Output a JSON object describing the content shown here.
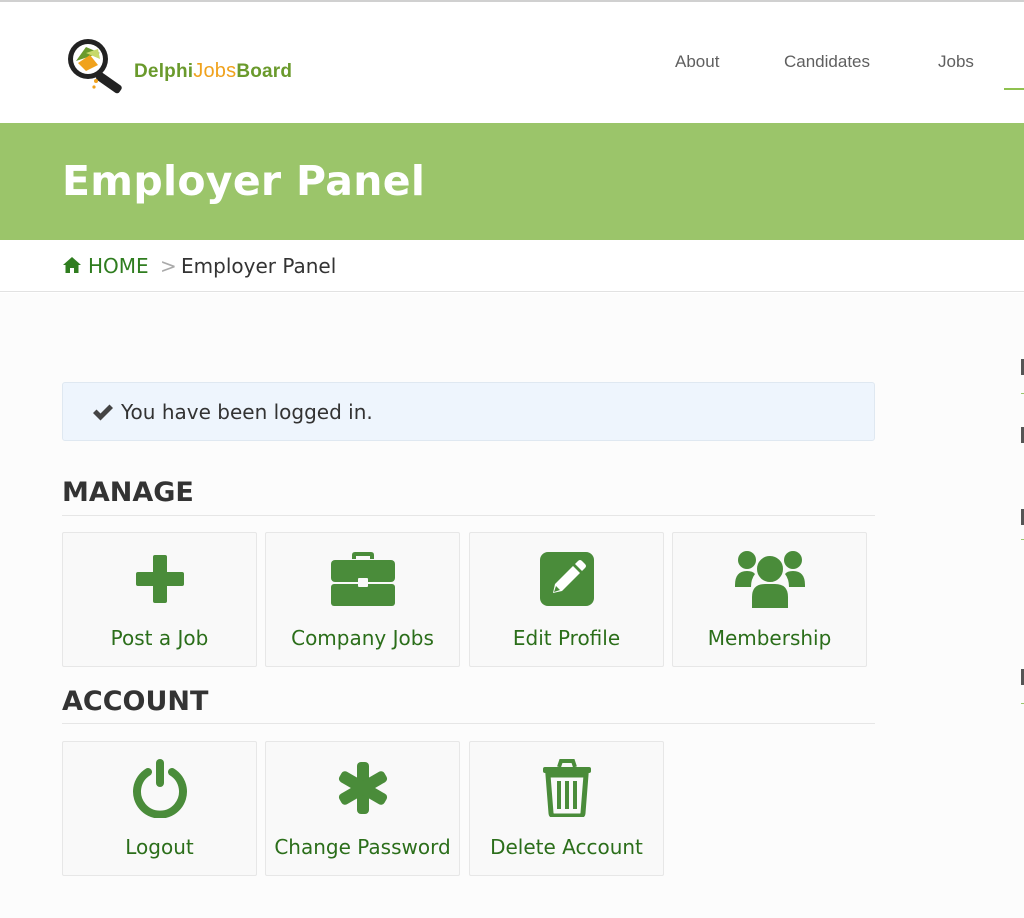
{
  "header": {
    "logo": {
      "part1": "Delphi",
      "part2": "Jobs",
      "part3": "Board",
      "icon": "magnifier-logo-icon"
    },
    "nav": [
      {
        "label": "About"
      },
      {
        "label": "Candidates"
      },
      {
        "label": "Jobs"
      }
    ]
  },
  "banner": {
    "title": "Employer Panel"
  },
  "breadcrumb": {
    "home": "HOME",
    "separator": ">",
    "current": "Employer Panel",
    "home_icon": "home-icon"
  },
  "alert": {
    "icon": "check-icon",
    "text": "You have been logged in."
  },
  "sections": {
    "manage": {
      "title": "MANAGE",
      "tiles": [
        {
          "label": "Post a Job",
          "icon": "plus-icon"
        },
        {
          "label": "Company Jobs",
          "icon": "briefcase-icon"
        },
        {
          "label": "Edit Profile",
          "icon": "edit-icon"
        },
        {
          "label": "Membership",
          "icon": "users-icon"
        }
      ]
    },
    "account": {
      "title": "ACCOUNT",
      "tiles": [
        {
          "label": "Logout",
          "icon": "power-icon"
        },
        {
          "label": "Change Password",
          "icon": "asterisk-icon"
        },
        {
          "label": "Delete Account",
          "icon": "trash-icon"
        }
      ]
    }
  },
  "colors": {
    "brand_green": "#9bc56a",
    "link_green": "#2b6e1a",
    "icon_green": "#4a8c3a",
    "alert_bg": "#eef5fd"
  }
}
